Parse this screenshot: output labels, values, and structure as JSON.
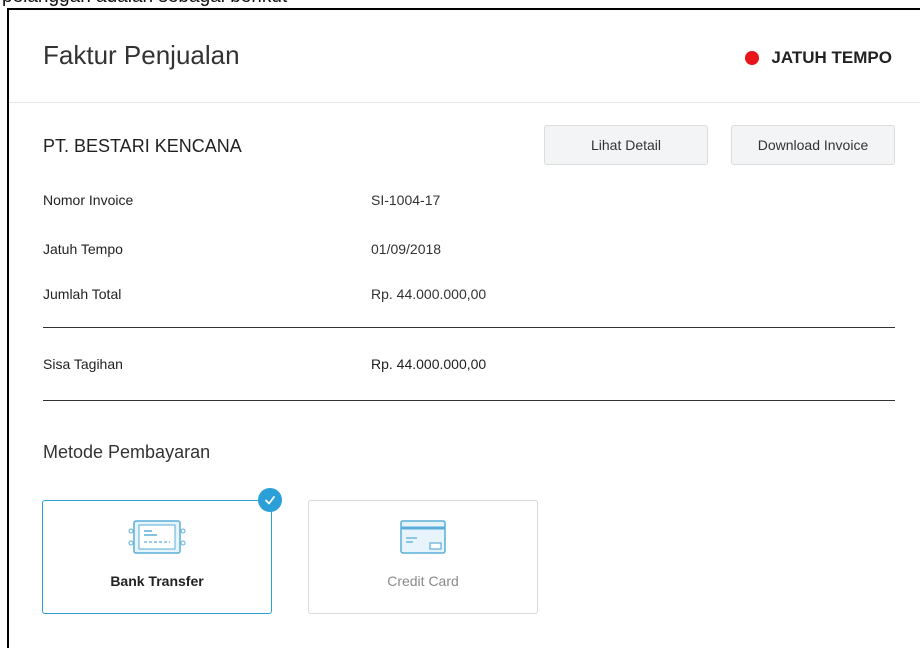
{
  "header": {
    "cropped_text": "pelanggan adalah sebagai berikut",
    "title": "Faktur Penjualan",
    "status_label": "JATUH TEMPO",
    "status_color": "#e8131b"
  },
  "invoice": {
    "company": "PT. BESTARI KENCANA",
    "buttons": {
      "detail_label": "Lihat Detail",
      "download_label": "Download Invoice"
    },
    "rows": [
      {
        "label": "Nomor Invoice",
        "value": "SI-1004-17"
      },
      {
        "label": "Jatuh Tempo",
        "value": "01/09/2018"
      },
      {
        "label": "Jumlah Total",
        "value": "Rp. 44.000.000,00"
      }
    ],
    "balance": {
      "label": "Sisa Tagihan",
      "value": "Rp. 44.000.000,00"
    }
  },
  "payment": {
    "section_title": "Metode Pembayaran",
    "methods": [
      {
        "label": "Bank Transfer",
        "icon": "bank-transfer-icon",
        "selected": true
      },
      {
        "label": "Credit Card",
        "icon": "credit-card-icon",
        "selected": false
      }
    ],
    "accent_color": "#2a9fd8"
  }
}
